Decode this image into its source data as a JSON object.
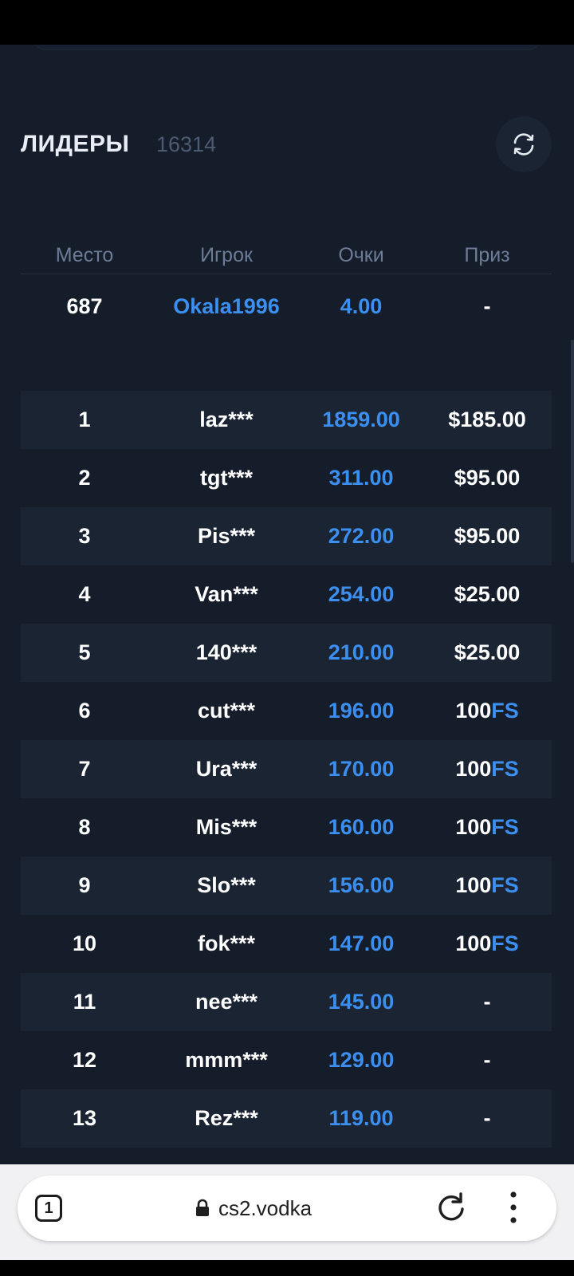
{
  "header": {
    "title": "ЛИДЕРЫ",
    "count": "16314"
  },
  "columns": {
    "place": "Место",
    "player": "Игрок",
    "points": "Очки",
    "prize": "Приз"
  },
  "current_user": {
    "place": "687",
    "player": "Okala1996",
    "points": "4.00",
    "prize": "-"
  },
  "rows": [
    {
      "place": "1",
      "player": "laz***",
      "points": "1859.00",
      "prize": "$185.00",
      "prize_suffix": ""
    },
    {
      "place": "2",
      "player": "tgt***",
      "points": "311.00",
      "prize": "$95.00",
      "prize_suffix": ""
    },
    {
      "place": "3",
      "player": "Pis***",
      "points": "272.00",
      "prize": "$95.00",
      "prize_suffix": ""
    },
    {
      "place": "4",
      "player": "Van***",
      "points": "254.00",
      "prize": "$25.00",
      "prize_suffix": ""
    },
    {
      "place": "5",
      "player": "140***",
      "points": "210.00",
      "prize": "$25.00",
      "prize_suffix": ""
    },
    {
      "place": "6",
      "player": "cut***",
      "points": "196.00",
      "prize": "100",
      "prize_suffix": "FS"
    },
    {
      "place": "7",
      "player": "Ura***",
      "points": "170.00",
      "prize": "100",
      "prize_suffix": "FS"
    },
    {
      "place": "8",
      "player": "Mis***",
      "points": "160.00",
      "prize": "100",
      "prize_suffix": "FS"
    },
    {
      "place": "9",
      "player": "Slo***",
      "points": "156.00",
      "prize": "100",
      "prize_suffix": "FS"
    },
    {
      "place": "10",
      "player": "fok***",
      "points": "147.00",
      "prize": "100",
      "prize_suffix": "FS"
    },
    {
      "place": "11",
      "player": "nee***",
      "points": "145.00",
      "prize": "-",
      "prize_suffix": ""
    },
    {
      "place": "12",
      "player": "mmm***",
      "points": "129.00",
      "prize": "-",
      "prize_suffix": ""
    },
    {
      "place": "13",
      "player": "Rez***",
      "points": "119.00",
      "prize": "-",
      "prize_suffix": ""
    }
  ],
  "browser": {
    "tab_count": "1",
    "url": "cs2.vodka"
  },
  "icons": {
    "refresh": "refresh-icon",
    "lock": "lock-icon",
    "reload": "reload-icon",
    "menu": "more-vertical-icon"
  },
  "colors": {
    "background": "#151c2a",
    "row_alt": "#1b2433",
    "accent": "#3b8ff0",
    "muted": "#6d7c96"
  }
}
